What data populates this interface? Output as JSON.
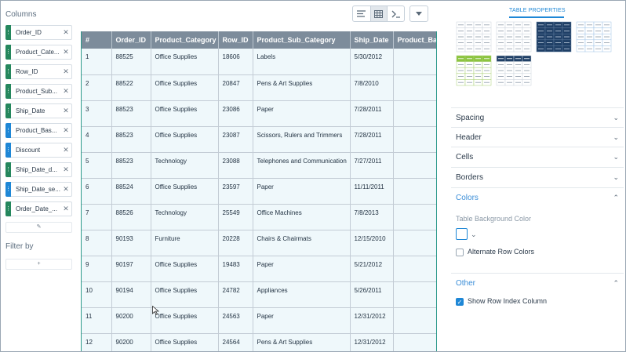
{
  "left": {
    "columns_title": "Columns",
    "chips": [
      {
        "label": "Order_ID",
        "color": "green"
      },
      {
        "label": "Product_Cate...",
        "color": "green"
      },
      {
        "label": "Row_ID",
        "color": "green"
      },
      {
        "label": "Product_Sub...",
        "color": "green"
      },
      {
        "label": "Ship_Date",
        "color": "green"
      },
      {
        "label": "Product_Bas...",
        "color": "blue"
      },
      {
        "label": "Discount",
        "color": "blue"
      },
      {
        "label": "Ship_Date_d...",
        "color": "green"
      },
      {
        "label": "Ship_Date_se...",
        "color": "blue"
      },
      {
        "label": "Order_Date_...",
        "color": "green"
      }
    ],
    "filter_title": "Filter by",
    "add_symbol": "+",
    "edit_symbol": "✎"
  },
  "toolbar": {
    "icons": [
      "align-icon",
      "table-icon",
      "console-icon",
      "dropdown-icon"
    ]
  },
  "table": {
    "headers": [
      "#",
      "Order_ID",
      "Product_Category",
      "Row_ID",
      "Product_Sub_Category",
      "Ship_Date",
      "Product_Ba"
    ],
    "rows": [
      [
        "1",
        "88525",
        "Office Supplies",
        "18606",
        "Labels",
        "5/30/2012",
        ""
      ],
      [
        "2",
        "88522",
        "Office Supplies",
        "20847",
        "Pens & Art Supplies",
        "7/8/2010",
        ""
      ],
      [
        "3",
        "88523",
        "Office Supplies",
        "23086",
        "Paper",
        "7/28/2011",
        ""
      ],
      [
        "4",
        "88523",
        "Office Supplies",
        "23087",
        "Scissors, Rulers and Trimmers",
        "7/28/2011",
        ""
      ],
      [
        "5",
        "88523",
        "Technology",
        "23088",
        "Telephones and Communication",
        "7/27/2011",
        ""
      ],
      [
        "6",
        "88524",
        "Office Supplies",
        "23597",
        "Paper",
        "11/11/2011",
        ""
      ],
      [
        "7",
        "88526",
        "Technology",
        "25549",
        "Office Machines",
        "7/8/2013",
        ""
      ],
      [
        "8",
        "90193",
        "Furniture",
        "20228",
        "Chairs & Chairmats",
        "12/15/2010",
        ""
      ],
      [
        "9",
        "90197",
        "Office Supplies",
        "19483",
        "Paper",
        "5/21/2012",
        ""
      ],
      [
        "10",
        "90194",
        "Office Supplies",
        "24782",
        "Appliances",
        "5/26/2011",
        ""
      ],
      [
        "11",
        "90200",
        "Office Supplies",
        "24563",
        "Paper",
        "12/31/2012",
        ""
      ],
      [
        "12",
        "90200",
        "Office Supplies",
        "24564",
        "Pens & Art Supplies",
        "12/31/2012",
        ""
      ]
    ]
  },
  "right": {
    "tab_label": "TABLE PROPERTIES",
    "sections": [
      "Spacing",
      "Header",
      "Cells",
      "Borders",
      "Colors",
      "Other"
    ],
    "bg_color_label": "Table Background Color",
    "alt_rows_label": "Alternate Row Colors",
    "show_index_label": "Show Row Index Column"
  },
  "colors": {
    "accent": "#1e87d6",
    "green": "#25875d",
    "header": "#7d8c9b",
    "navy": "#1f3f66",
    "lime": "#8cc43f",
    "table_bg": "#eff8fb"
  }
}
